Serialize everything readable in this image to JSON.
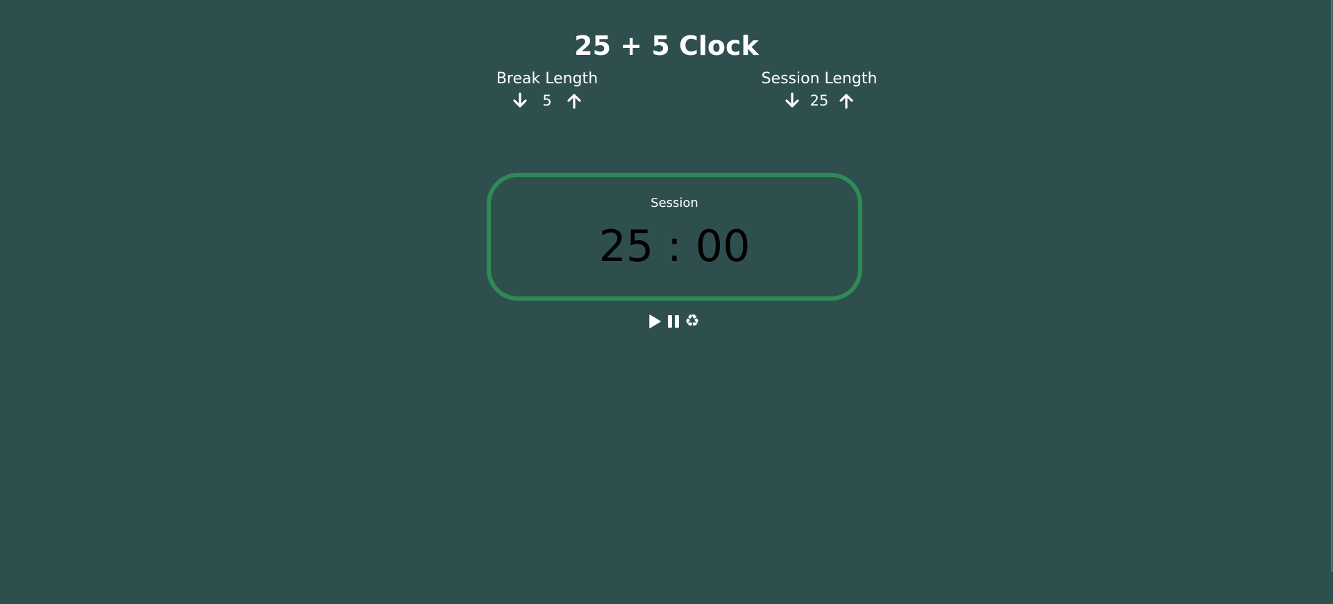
{
  "app": {
    "title": "25 + 5 Clock"
  },
  "break": {
    "label": "Break Length",
    "value": "5",
    "decrement_icon": "arrow-down-icon",
    "increment_icon": "arrow-up-icon"
  },
  "session": {
    "label": "Session Length",
    "value": "25",
    "decrement_icon": "arrow-down-icon",
    "increment_icon": "arrow-up-icon"
  },
  "timer": {
    "label": "Session",
    "time_left": "25 : 00"
  },
  "controls": {
    "start_icon": "play-icon",
    "pause_icon": "pause-icon",
    "reset_icon": "recycle-icon",
    "reset_glyph": "♻"
  },
  "colors": {
    "background": "#2f4f4f",
    "timer_border": "#2e8b57",
    "text": "#ffffff",
    "time_text": "#000000"
  }
}
